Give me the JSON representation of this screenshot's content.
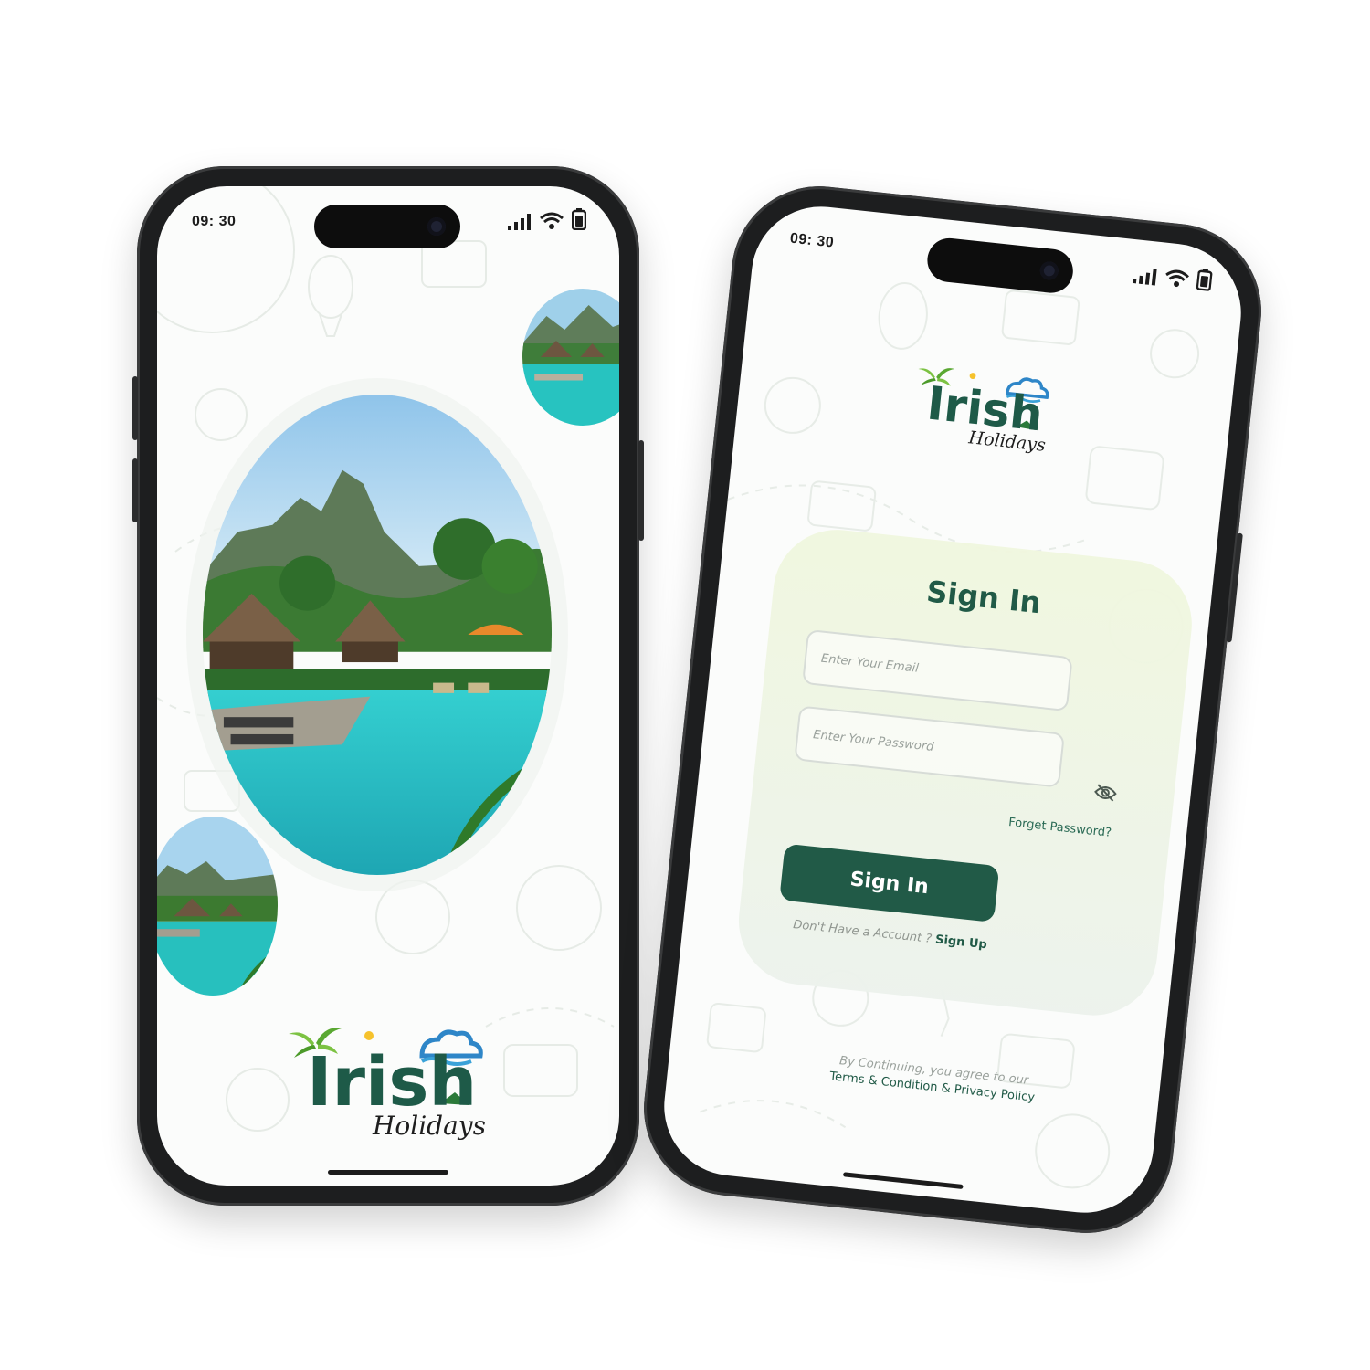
{
  "splash_screen": {
    "status": {
      "time": "09: 30"
    },
    "logo": {
      "word": "Irish",
      "subtitle": "Holidays"
    }
  },
  "signin_screen": {
    "status": {
      "time": "09: 30"
    },
    "logo": {
      "word": "Irish",
      "subtitle": "Holidays"
    },
    "title": "Sign In",
    "email": {
      "placeholder": "Enter Your Email"
    },
    "password": {
      "placeholder": "Enter Your Password"
    },
    "forgot_label": "Forget Password?",
    "submit_label": "Sign In",
    "signup_prompt": "Don't Have a Account ?",
    "signup_label": "Sign Up",
    "terms_prefix": "By Continuing, you agree to our",
    "terms_link": "Terms & Condition & Privacy Policy"
  },
  "colors": {
    "brand_green": "#215a47",
    "card_bg": "#eef4e6",
    "pool_turquoise": "#25c4c2",
    "phone_frame": "#1d1e1f"
  },
  "icons": [
    "signal-icon",
    "wifi-icon",
    "battery-icon",
    "eye-off-icon",
    "palm-tree-icon",
    "cloud-icon"
  ]
}
